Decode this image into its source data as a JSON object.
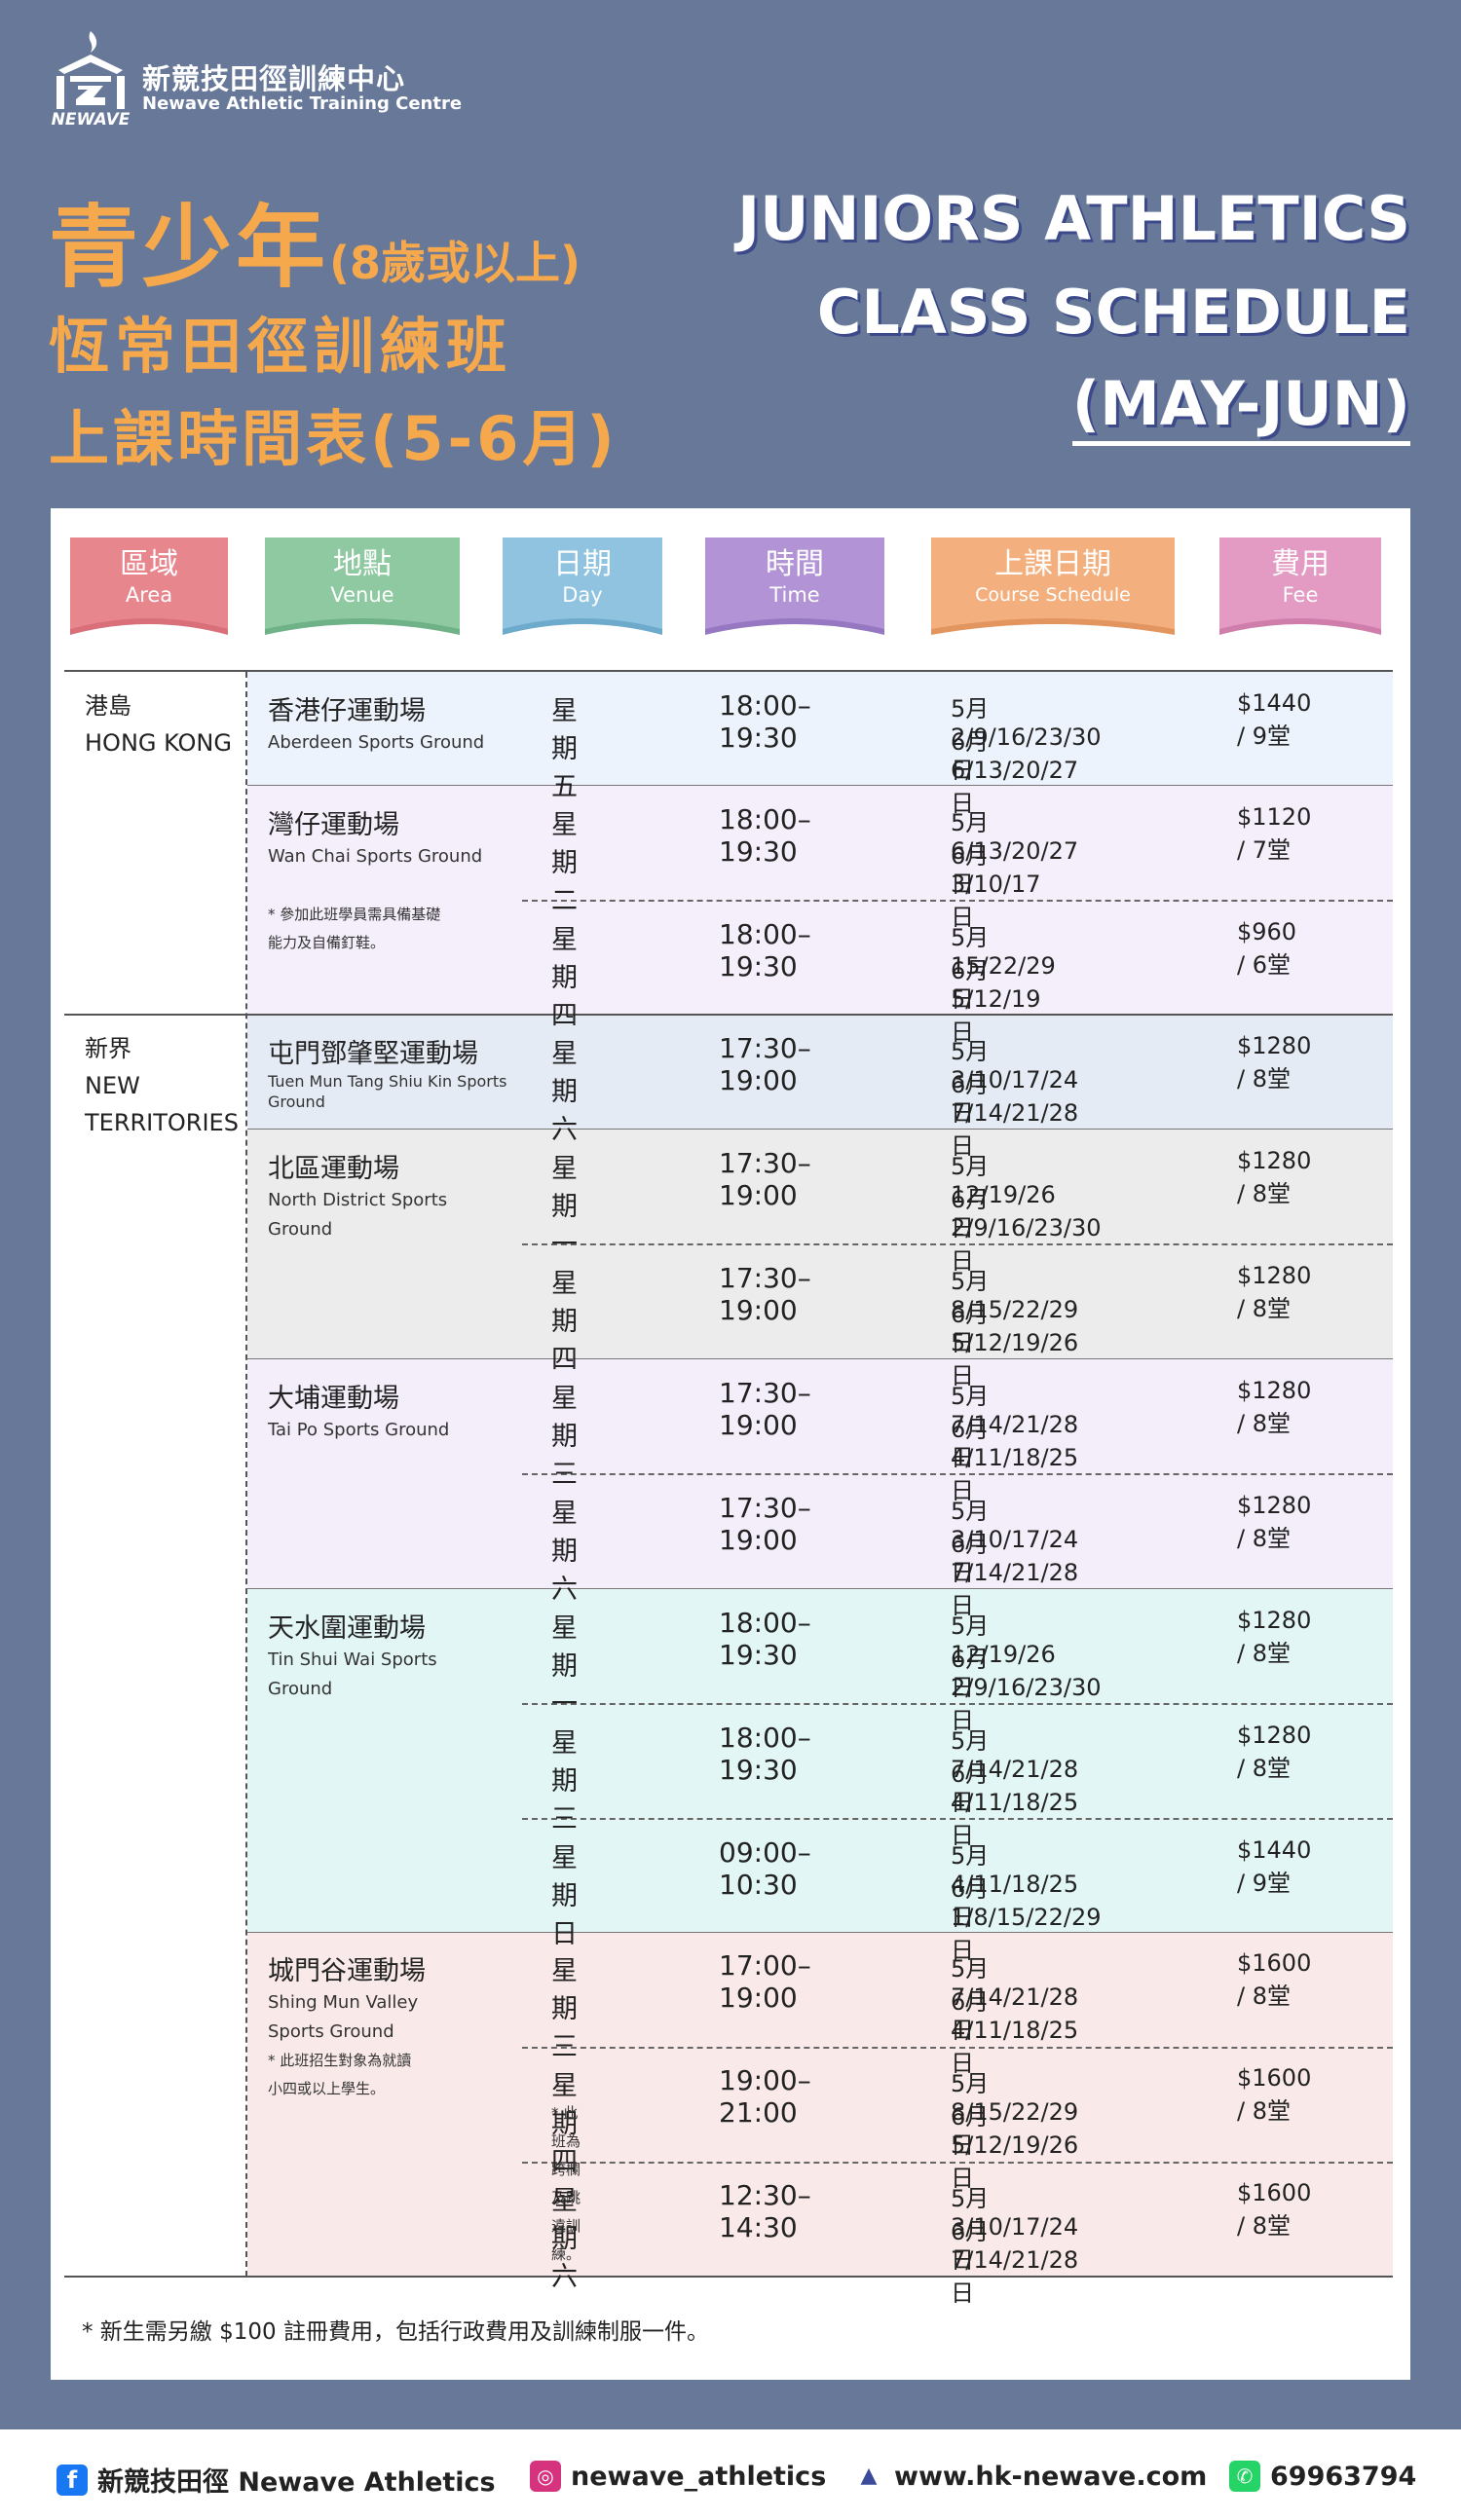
{
  "brand": {
    "zh": "新競技田徑訓練中心",
    "en": "Newave Athletic Training Centre",
    "logo_text": "NEWAVE"
  },
  "title_zh": {
    "line1": "青少年",
    "line1_small": "(8歲或以上)",
    "line2": "恆常田徑訓練班",
    "line3": "上課時間表(5-6月)"
  },
  "title_en": {
    "line1": "JUNIORS ATHLETICS",
    "line2": "CLASS SCHEDULE",
    "line3": "(MAY-JUN)"
  },
  "headers": [
    {
      "zh": "區域",
      "en": "Area",
      "color": "#e8868e"
    },
    {
      "zh": "地點",
      "en": "Venue",
      "color": "#8ec9a2"
    },
    {
      "zh": "日期",
      "en": "Day",
      "color": "#8fc3df"
    },
    {
      "zh": "時間",
      "en": "Time",
      "color": "#b293d6"
    },
    {
      "zh": "上課日期",
      "en": "Course Schedule",
      "color": "#f3b07e"
    },
    {
      "zh": "費用",
      "en": "Fee",
      "color": "#e39ac3"
    }
  ],
  "areas": [
    {
      "zh": "港島",
      "en": "HONG KONG"
    },
    {
      "zh": "新界",
      "en": "NEW",
      "en2": "TERRITORIES"
    }
  ],
  "venues": [
    {
      "zh": "香港仔運動場",
      "en": "Aberdeen Sports Ground",
      "bg": "#edf3fd"
    },
    {
      "zh": "灣仔運動場",
      "en": "Wan Chai Sports Ground",
      "note1": "* 參加此班學員需具備基礎",
      "note2": "能力及自備釘鞋。",
      "bg": "#f4effa"
    },
    {
      "zh": "屯門鄧肇堅運動場",
      "en": "Tuen Mun Tang Shiu Kin Sports",
      "en2": "Ground",
      "bg": "#e5ebf5"
    },
    {
      "zh": "北區運動場",
      "en": "North District Sports",
      "en2": "Ground",
      "bg": "#ececec"
    },
    {
      "zh": "大埔運動場",
      "en": "Tai Po Sports Ground",
      "bg": "#f4eefa"
    },
    {
      "zh": "天水圍運動場",
      "en": "Tin Shui Wai Sports",
      "en2": "Ground",
      "bg": "#e2f7f5"
    },
    {
      "zh": "城門谷運動場",
      "en": "Shing Mun Valley",
      "en2": "Sports Ground",
      "note1": "* 此班招生對象為就讀",
      "note2": "小四或以上學生。",
      "bg": "#f9eae9"
    }
  ],
  "rows": [
    {
      "day": "星期五",
      "time": "18:00–19:30",
      "d1": "5月2/9/16/23/30日",
      "d2": "6月6/13/20/27日",
      "fee": "$1440 / 9堂"
    },
    {
      "day": "星期二",
      "time": "18:00–19:30",
      "d1": "5月6/13/20/27日",
      "d2": "6月3/10/17日",
      "fee": "$1120 / 7堂"
    },
    {
      "day": "星期四",
      "time": "18:00–19:30",
      "d1": "5月15/22/29日",
      "d2": "6月5/12/19日",
      "fee": "$960 / 6堂"
    },
    {
      "day": "星期六",
      "time": "17:30–19:00",
      "d1": "5月3/10/17/24日",
      "d2": "6月7/14/21/28日",
      "fee": "$1280 / 8堂"
    },
    {
      "day": "星期一",
      "time": "17:30–19:00",
      "d1": "5月12/19/26日",
      "d2": "6月2/9/16/23/30日",
      "fee": "$1280 / 8堂"
    },
    {
      "day": "星期四",
      "time": "17:30–19:00",
      "d1": "5月8/15/22/29日",
      "d2": "6月5/12/19/26日",
      "fee": "$1280 / 8堂"
    },
    {
      "day": "星期三",
      "time": "17:30–19:00",
      "d1": "5月7/14/21/28日",
      "d2": "6月4/11/18/25日",
      "fee": "$1280 / 8堂"
    },
    {
      "day": "星期六",
      "time": "17:30–19:00",
      "d1": "5月3/10/17/24日",
      "d2": "6月7/14/21/28日",
      "fee": "$1280 / 8堂"
    },
    {
      "day": "星期一",
      "time": "18:00–19:30",
      "d1": "5月12/19/26日",
      "d2": "6月2/9/16/23/30日",
      "fee": "$1280 / 8堂"
    },
    {
      "day": "星期三",
      "time": "18:00–19:30",
      "d1": "5月7/14/21/28日",
      "d2": "6月4/11/18/25日",
      "fee": "$1280 / 8堂"
    },
    {
      "day": "星期日",
      "time": "09:00–10:30",
      "d1": "5月4/11/18/25日",
      "d2": "6月1/8/15/22/29日",
      "fee": "$1440 / 9堂"
    },
    {
      "day": "星期三",
      "time": "17:00–19:00",
      "d1": "5月7/14/21/28日",
      "d2": "6月4/11/18/25日",
      "fee": "$1600 / 8堂"
    },
    {
      "day": "星期四",
      "time": "19:00–21:00",
      "d1": "5月8/15/22/29日",
      "d2": "6月5/12/19/26日",
      "fee": "$1600 / 8堂",
      "note": "* 此班為跨欄及跳遠訓練。"
    },
    {
      "day": "星期六",
      "time": "12:30–14:30",
      "d1": "5月3/10/17/24日",
      "d2": "6月7/14/21/28日",
      "fee": "$1600 / 8堂"
    }
  ],
  "footnote": "* 新生需另繳 $100 註冊費用，包括行政費用及訓練制服一件。",
  "contacts": {
    "facebook": "新競技田徑 Newave Athletics",
    "instagram": "newave_athletics",
    "website": "www.hk-newave.com",
    "whatsapp": "69963794"
  }
}
